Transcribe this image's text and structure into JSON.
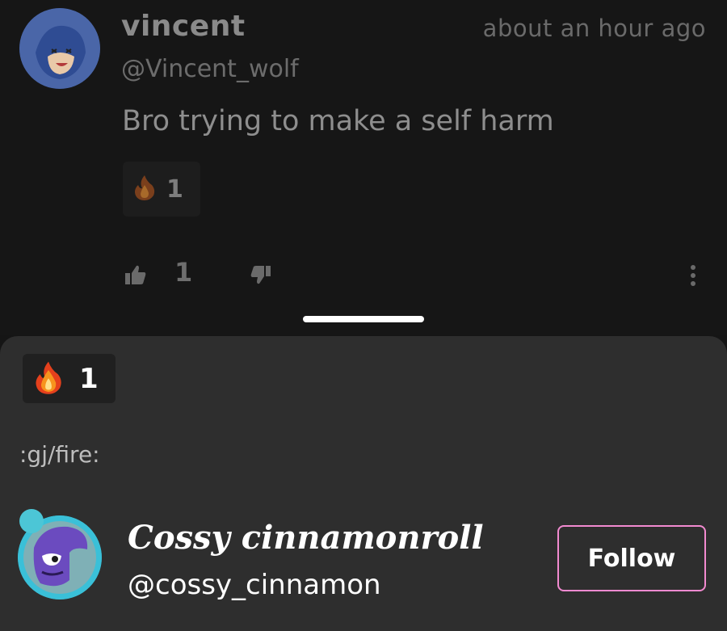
{
  "comment": {
    "username": "vincent",
    "handle": "@Vincent_wolf",
    "timestamp": "about an hour ago",
    "text": "Bro trying to make a self harm",
    "reaction_count": "1",
    "like_count": "1"
  },
  "sheet": {
    "reaction_count": "1",
    "emoji_code": ":gj/fire:",
    "user": {
      "display_name": "Cossy cinnamonroll",
      "handle": "@cossy_cinnamon"
    },
    "follow_label": "Follow"
  },
  "colors": {
    "accent_follow_border": "#f28ad0",
    "sheet_background": "#2e2e2e",
    "page_background": "#151515"
  },
  "icons": [
    "fire-icon",
    "thumbs-up-icon",
    "thumbs-down-icon",
    "more-vertical-icon"
  ]
}
